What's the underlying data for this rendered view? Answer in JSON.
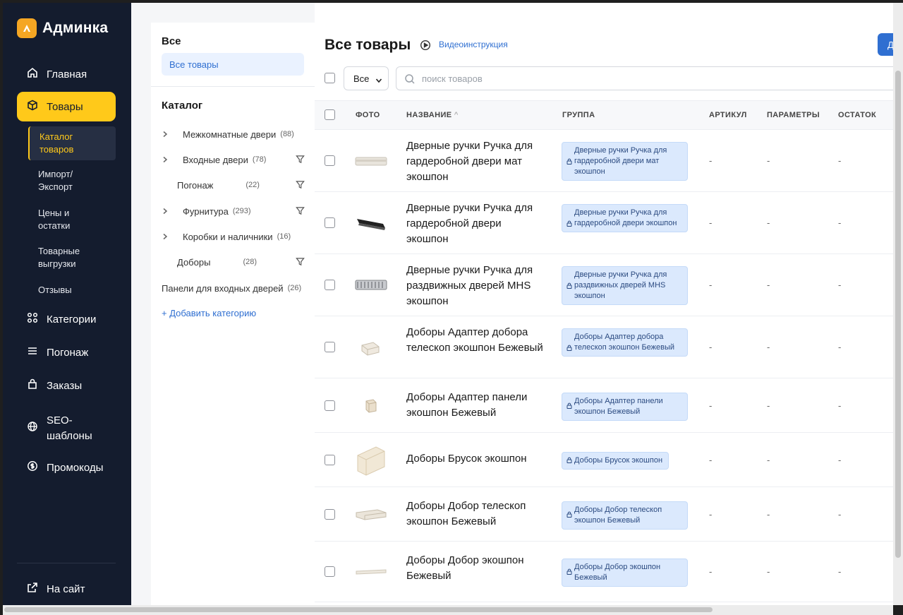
{
  "app": {
    "name": "Админка"
  },
  "sidebar": {
    "items": [
      {
        "label": "Главная",
        "icon": "home-icon"
      },
      {
        "label": "Товары",
        "icon": "box-icon",
        "active": true
      },
      {
        "label": "Категории",
        "icon": "grid-icon"
      },
      {
        "label": "Погонаж",
        "icon": "menu-icon"
      },
      {
        "label": "Заказы",
        "icon": "bag-icon"
      },
      {
        "label": "SEO-шаблоны",
        "line1": "SEO-",
        "line2": "шаблоны",
        "icon": "globe-icon"
      },
      {
        "label": "Промокоды",
        "icon": "dollar-icon"
      }
    ],
    "sub_items": [
      {
        "line1": "Каталог",
        "line2": "товаров",
        "active": true
      },
      {
        "line1": "Импорт/",
        "line2": "Экспорт"
      },
      {
        "line1": "Цены и",
        "line2": "остатки"
      },
      {
        "line1": "Товарные",
        "line2": "выгрузки"
      },
      {
        "line1": "Отзывы",
        "line2": ""
      }
    ],
    "footer_link": "На сайт"
  },
  "categories": {
    "all_heading": "Все",
    "all_goods": "Все товары",
    "catalog_heading": "Каталог",
    "items": [
      {
        "name": "Межкомнатные двери",
        "count": "(88)",
        "expandable": true,
        "filter": false
      },
      {
        "name": "Входные двери",
        "count": "(78)",
        "expandable": true,
        "filter": true
      },
      {
        "name": "Погонаж",
        "count": "(22)",
        "expandable": false,
        "filter": true
      },
      {
        "name": "Фурнитура",
        "count": "(293)",
        "expandable": true,
        "filter": true
      },
      {
        "name": "Коробки и наличники",
        "count": "(16)",
        "expandable": true,
        "filter": false
      },
      {
        "name": "Доборы",
        "count": "(28)",
        "expandable": false,
        "filter": true
      },
      {
        "name": "Панели для входных дверей",
        "count": "(26)",
        "expandable": false,
        "filter": false
      }
    ],
    "add_label": "+ Добавить категорию"
  },
  "main": {
    "title": "Все товары",
    "video_link": "Видеоинструкция",
    "add_button": "Д",
    "filter_select": "Все",
    "search_placeholder": "поиск товаров",
    "columns": {
      "photo": "ФОТО",
      "name": "НАЗВАНИЕ",
      "group": "ГРУППА",
      "sku": "АРТИКУЛ",
      "params": "ПАРАМЕТРЫ",
      "stock": "ОСТАТОК"
    },
    "sort_indicator": "^",
    "rows": [
      {
        "name": "Дверные ручки Ручка для гардеробной двери мат экошпон",
        "group": "Дверные ручки Ручка для гардеробной двери мат экошпон",
        "sku": "-",
        "params": "-",
        "stock": "-"
      },
      {
        "name": "Дверные ручки Ручка для гардеробной двери экошпон",
        "group": "Дверные ручки Ручка для гардеробной двери экошпон",
        "sku": "-",
        "params": "-",
        "stock": "-"
      },
      {
        "name": "Дверные ручки Ручка для раздвижных дверей MHS экошпон",
        "group": "Дверные ручки Ручка для раздвижных дверей MHS экошпон",
        "sku": "-",
        "params": "-",
        "stock": "-"
      },
      {
        "name": "Доборы Адаптер добора телескоп экошпон Бежевый",
        "group": "Доборы Адаптер добора телескоп экошпон Бежевый",
        "sku": "-",
        "params": "-",
        "stock": "-"
      },
      {
        "name": "Доборы Адаптер панели экошпон Бежевый",
        "group": "Доборы Адаптер панели экошпон Бежевый",
        "sku": "-",
        "params": "-",
        "stock": "-"
      },
      {
        "name": "Доборы Брусок экошпон",
        "group": "Доборы Брусок экошпон",
        "sku": "-",
        "params": "-",
        "stock": "-"
      },
      {
        "name": "Доборы Добор телескоп экошпон Бежевый",
        "group": "Доборы Добор телескоп экошпон Бежевый",
        "sku": "-",
        "params": "-",
        "stock": "-"
      },
      {
        "name": "Доборы Добор экошпон Бежевый",
        "group": "Доборы Добор экошпон Бежевый",
        "sku": "-",
        "params": "-",
        "stock": "-"
      }
    ]
  },
  "colors": {
    "sidebar_bg": "#141c2e",
    "accent": "#ffc91a",
    "link": "#2f6fd1",
    "tag_bg": "#dbe9fd"
  }
}
